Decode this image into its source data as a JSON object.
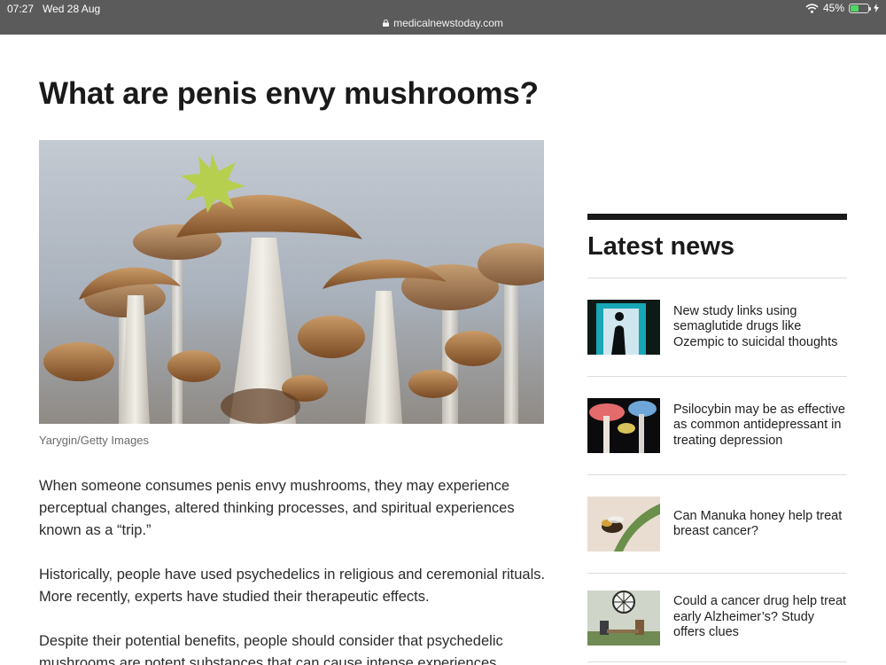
{
  "status_bar": {
    "time": "07:27",
    "date": "Wed 28 Aug",
    "url": "medicalnewstoday.com",
    "battery_percent": "45%",
    "battery_level": 0.45
  },
  "article": {
    "title": "What are penis envy mushrooms?",
    "image_caption": "Yarygin/Getty Images",
    "paragraphs": [
      "When someone consumes penis envy mushrooms, they may experience perceptual changes, altered thinking processes, and spiritual experiences known as a “trip.”",
      "Historically, people have used psychedelics in religious and ceremonial rituals. More recently, experts have studied their therapeutic effects.",
      "Despite their potential benefits, people should consider that psychedelic mushrooms are potent substances that can cause intense experiences."
    ]
  },
  "sidebar": {
    "title": "Latest news",
    "items": [
      {
        "label": "New study links using semaglutide drugs like Ozempic to suicidal thoughts"
      },
      {
        "label": "Psilocybin may be as effective as common antidepressant in treating depression"
      },
      {
        "label": "Can Manuka honey help treat breast cancer?"
      },
      {
        "label": "Could a cancer drug help treat early Alzheimer’s? Study offers clues"
      }
    ]
  },
  "colors": {
    "status_bar_bg": "#5b5b5b",
    "accent_green": "#b7cf4f",
    "battery_green": "#4cd964"
  }
}
